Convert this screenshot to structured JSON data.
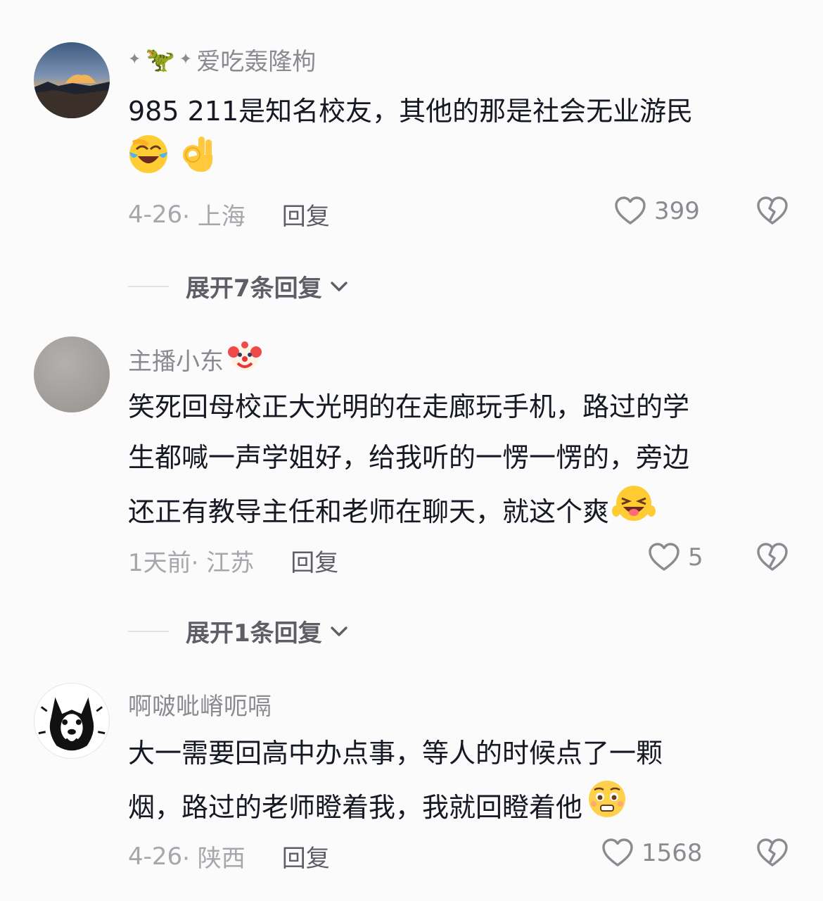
{
  "comments": [
    {
      "username": "爱吃轰隆枸",
      "text": "985 211是知名校友，其他的那是社会无业游民",
      "date": "4-26",
      "location": "· 上海",
      "reply_label": "回复",
      "likes": "399",
      "expand_label": "展开7条回复"
    },
    {
      "username": "主播小东",
      "text_lines": [
        "笑死回母校正大光明的在走廊玩手机，路过的学",
        "生都喊一声学姐好，给我听的一愣一愣的，旁边",
        "还正有教导主任和老师在聊天，就这个爽"
      ],
      "date": "1天前",
      "location": " · 江苏",
      "reply_label": "回复",
      "likes": "5",
      "expand_label": "展开1条回复"
    },
    {
      "username": "啊啵呲嵴呃嗝",
      "text_lines": [
        "大一需要回高中办点事，等人的时候点了一颗",
        "烟，路过的老师瞪着我，我就回瞪着他"
      ],
      "date": "4-26",
      "location": "· 陕西",
      "reply_label": "回复",
      "likes": "1568"
    }
  ],
  "icons": {
    "like": "heart-outline-icon",
    "dislike": "broken-heart-icon",
    "expand": "chevron-down-icon"
  }
}
